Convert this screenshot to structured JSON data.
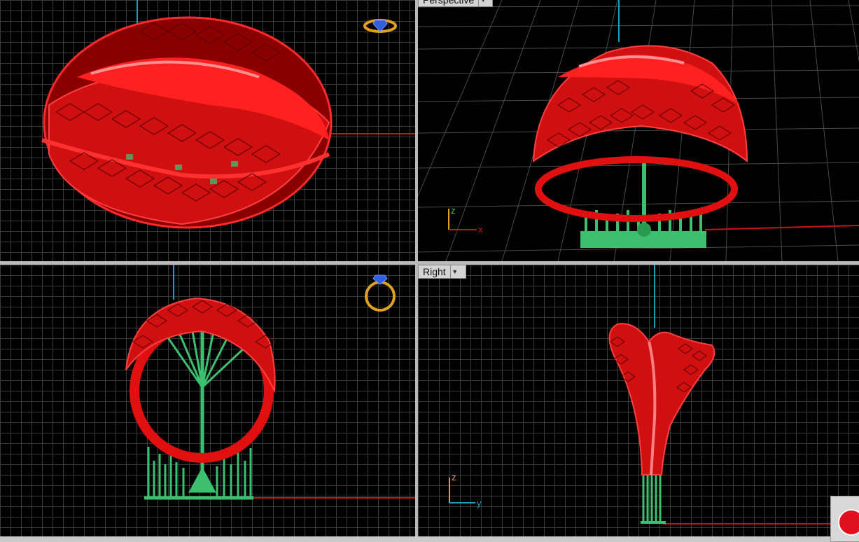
{
  "viewports": {
    "top": {
      "label": ""
    },
    "perspective": {
      "label": "Perspective"
    },
    "front": {
      "label": ""
    },
    "right": {
      "label": "Right"
    }
  },
  "axes": {
    "perspective": {
      "x": "x",
      "z": "z"
    },
    "right": {
      "y": "y",
      "z": "z"
    }
  },
  "icons": {
    "top_widget": "ring-top-view-icon",
    "front_widget": "ring-front-view-icon",
    "dropdown": "chevron-down-icon",
    "record": "record-icon"
  },
  "colors": {
    "viewport_bg": "#000000",
    "grid": "#3a3a3a",
    "x_axis": "#c81414",
    "y_axis": "#1aa0b4",
    "model_red": "#e01010",
    "support_green": "#3cc070",
    "widget_gold": "#e0a020",
    "widget_blue": "#3060e0",
    "record_red": "#e0101e"
  }
}
